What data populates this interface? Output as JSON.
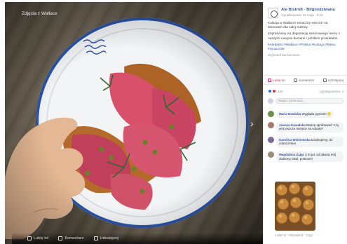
{
  "album": {
    "caption": "Zdjęcia z Wallace"
  },
  "photo_actions": [
    {
      "label": "Lubię to!"
    },
    {
      "label": "Komentarz"
    },
    {
      "label": "Udostępnij"
    }
  ],
  "post": {
    "page_name": "Ale Bistrołt - Bitgośdziwaną",
    "meta": "Opublikowane 12 maja · 8:26",
    "body": [
      "Kolacja w Wallace! Smaczny wieczór na Mazurach dla całej rodziny.",
      "Zapraszamy na degustację sezonowego menu z naszymi nowymi daniami i polskimi produktami."
    ],
    "hashtags": "#AleBistro #Wallace #Polska #Kolacja #Menu #Smacznie",
    "see_translation": "Wyświetl tłumaczenie"
  },
  "actions": {
    "like": "Lubię to!",
    "comment": "Komentarz",
    "share": "Udostępnij"
  },
  "reactions": {
    "count": "134",
    "shares": "Udostępnienia: 4"
  },
  "comment_box": {
    "placeholder": "Napisz komentarz..."
  },
  "comments": [
    {
      "name": "Maria Nowicka",
      "text": "Wygląda pysznie!"
    },
    {
      "name": "Joanna Kowalska",
      "text": "Muszę spróbować! Czy jest jeszcze miejsce na sobotę?"
    },
    {
      "name": "Karolina Wiśniewska",
      "text": "Dziękujemy, do zobaczenia!"
    },
    {
      "name": "Magdalena Zając",
      "text": "A to już od dawna mój ulubiony lokal, polecam!"
    }
  ],
  "comment_footer": "Lubię to! · Odpowiedz · 3 tyg.",
  "colors": {
    "link": "#365899",
    "like_active": "#e0245e",
    "plate_rim": "#2b54a8",
    "viewer_bg": "#1c1c1c"
  },
  "icons": {
    "next": "chevron-right-icon",
    "like": "thumbs-up-icon",
    "comment": "speech-bubble-icon",
    "share": "share-arrow-icon"
  },
  "uncertain": [
    "album.caption",
    "photo_actions.*.label",
    "post.page_name",
    "post.meta",
    "post.body.*",
    "post.hashtags",
    "post.see_translation",
    "actions.like",
    "actions.comment",
    "actions.share",
    "reactions.count",
    "reactions.shares",
    "comment_box.placeholder",
    "comments.*.name",
    "comments.*.text",
    "comment_footer"
  ]
}
